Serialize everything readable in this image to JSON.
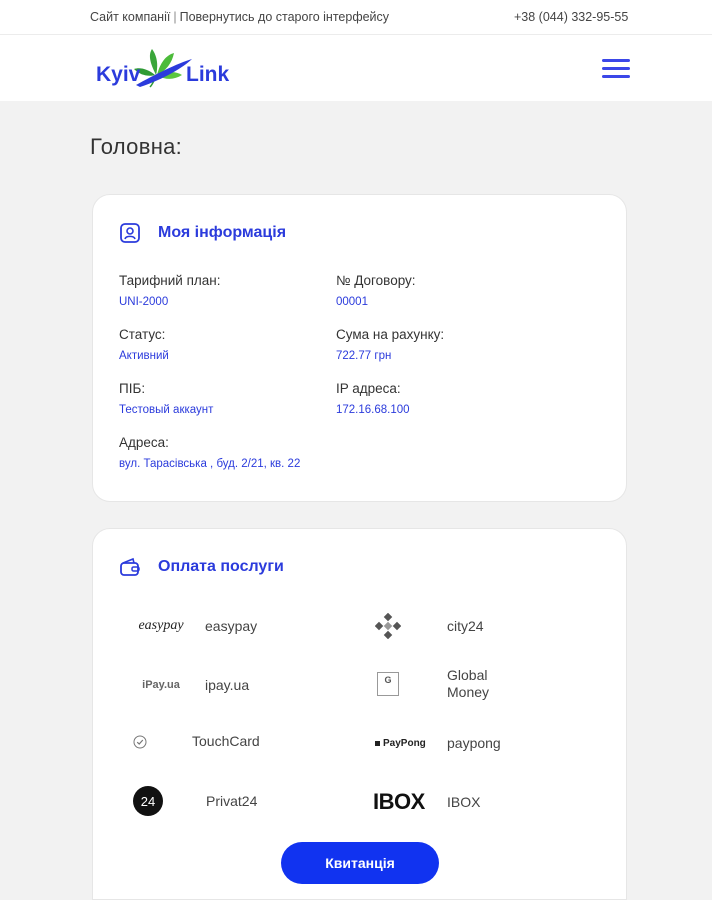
{
  "topbar": {
    "link_company": "Сайт компанії",
    "separator": "|",
    "link_old_ui": "Повернутись до старого інтерфейсу",
    "phone": "+38 (044) 332-95-55"
  },
  "header": {
    "logo_text_left": "Kyiv",
    "logo_text_right": "Link",
    "menu_icon": "hamburger-icon"
  },
  "page": {
    "title": "Головна:"
  },
  "info": {
    "title": "Моя інформація",
    "icon": "user-id-icon",
    "fields": {
      "tariff": {
        "label": "Тарифний план:",
        "value": "UNI-2000"
      },
      "contract": {
        "label": "№ Договору:",
        "value": "00001"
      },
      "status": {
        "label": "Статус:",
        "value": "Активний"
      },
      "balance": {
        "label": "Сума на рахунку:",
        "value": "722.77 грн"
      },
      "name": {
        "label": "ПІБ:",
        "value": "Тестовый аккаунт"
      },
      "ip": {
        "label": "IP адреса:",
        "value": "172.16.68.100"
      },
      "address": {
        "label": "Адреса:",
        "value": "вул. Тарасівська , буд. 2/21, кв. 22"
      }
    }
  },
  "payment": {
    "title": "Оплата послуги",
    "icon": "wallet-icon",
    "methods": {
      "easypay": {
        "logo_text": "easypay",
        "name": "easypay"
      },
      "city24": {
        "name": "city24"
      },
      "ipay": {
        "logo_text": "iPay.ua",
        "name": "ipay.ua"
      },
      "global": {
        "logo_text": "G",
        "name_line1": "Global",
        "name_line2": "Money"
      },
      "touchcard": {
        "name": "TouchCard"
      },
      "paypong": {
        "logo_text": "PayPong",
        "name": "paypong"
      },
      "privat24": {
        "logo_text": "24",
        "name": "Privat24"
      },
      "ibox": {
        "logo_text": "IBOX",
        "name": "IBOX"
      }
    },
    "receipt_button": "Квитанція"
  },
  "colors": {
    "accent": "#2b3bdc",
    "button": "#1133f0",
    "background": "#f2f2f2"
  }
}
